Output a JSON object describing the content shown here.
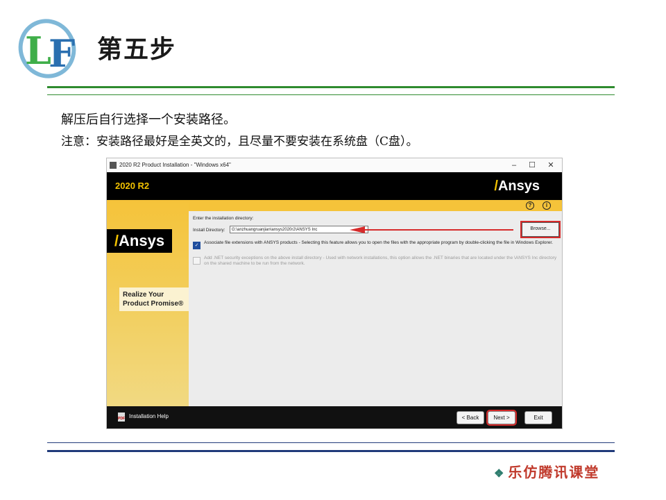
{
  "slide": {
    "logo_text": "LF",
    "title": "第五步",
    "line1": "解压后自行选择一个安装路径。",
    "line2": "注意：安装路径最好是全英文的，且尽量不要安装在系统盘（C盘）。",
    "footer_brand": "乐仿腾讯课堂"
  },
  "window": {
    "title": "2020 R2 Product Installation - \"Windows x64\"",
    "version": "2020 R2",
    "brand": "Ansys",
    "tagline_line1": "Realize Your",
    "tagline_line2": "Product Promise®",
    "prompt": "Enter the installation directory:",
    "dir_label": "Install Directory:",
    "dir_value": "G:\\anzhuangruanjian\\ansys2020r2\\ANSYS Inc",
    "browse_label": "Browse...",
    "option1": {
      "checked": true,
      "text": "Associate file extensions with ANSYS products - Selecting this feature allows you to open the files with the appropriate program by double-clicking the file in Windows Explorer."
    },
    "option2": {
      "checked": false,
      "text": "Add .NET security exceptions on the above install directory - Used with network installations, this option allows the .NET binaries that are located under the \\ANSYS Inc directory on the shared machine to be run from the network."
    },
    "help_label": "Installation Help",
    "back_label": "< Back",
    "next_label": "Next >",
    "exit_label": "Exit"
  },
  "colors": {
    "accent_yellow": "#f2c200",
    "highlight_red": "#d62a2a",
    "rule_green": "#2e8b2e",
    "rule_blue": "#203a7a"
  }
}
